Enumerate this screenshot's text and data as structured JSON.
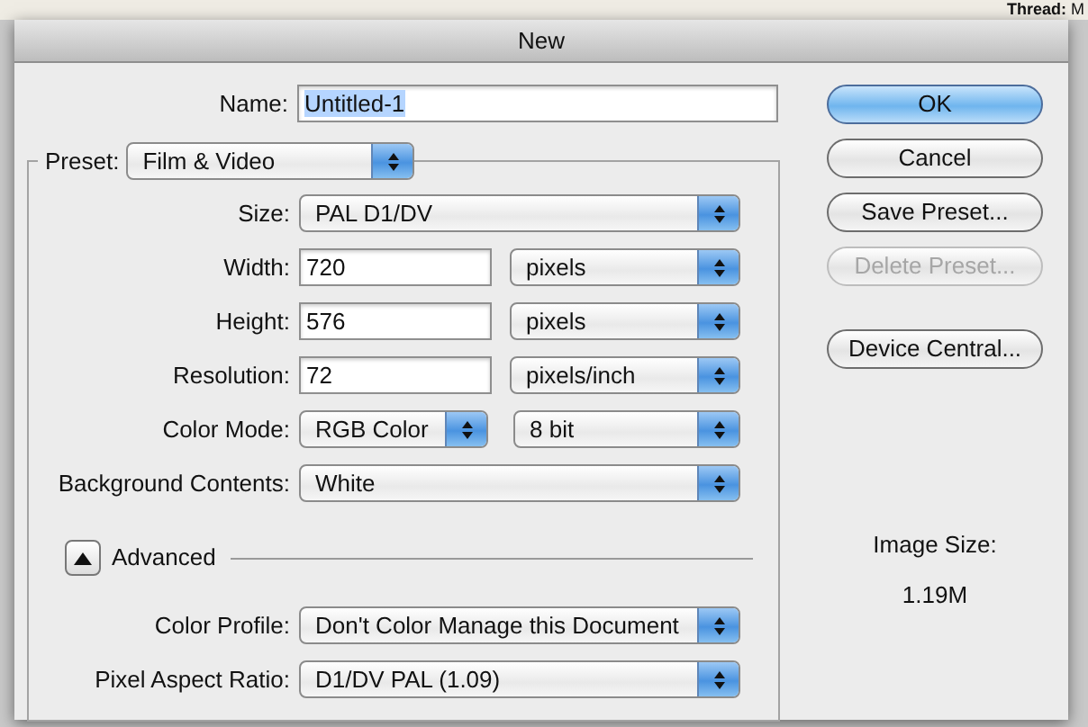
{
  "background": {
    "thread_label": "Thread:",
    "thread_value": "M"
  },
  "window": {
    "title": "New"
  },
  "name": {
    "label": "Name:",
    "value": "Untitled-1",
    "text_selected": true
  },
  "preset": {
    "label": "Preset:",
    "value": "Film & Video"
  },
  "fields": [
    {
      "kind": "popup",
      "label": "Size:",
      "value": "PAL D1/DV"
    },
    {
      "kind": "input_unit",
      "label": "Width:",
      "value": "720",
      "unit": "pixels"
    },
    {
      "kind": "input_unit",
      "label": "Height:",
      "value": "576",
      "unit": "pixels"
    },
    {
      "kind": "input_unit",
      "label": "Resolution:",
      "value": "72",
      "unit": "pixels/inch"
    },
    {
      "kind": "popup_pair",
      "label": "Color Mode:",
      "value": "RGB Color",
      "value_2": "8 bit"
    },
    {
      "kind": "popup",
      "label": "Background Contents:",
      "value": "White"
    }
  ],
  "advanced": {
    "label": "Advanced",
    "expanded": true,
    "fields": [
      {
        "kind": "popup",
        "label": "Color Profile:",
        "value": "Don't Color Manage this Document"
      },
      {
        "kind": "popup",
        "label": "Pixel Aspect Ratio:",
        "value": "D1/DV PAL (1.09)"
      }
    ]
  },
  "buttons": [
    {
      "label": "OK",
      "default": true,
      "disabled": false
    },
    {
      "label": "Cancel",
      "default": false,
      "disabled": false
    },
    {
      "label": "Save Preset...",
      "default": false,
      "disabled": false
    },
    {
      "label": "Delete Preset...",
      "default": false,
      "disabled": true
    },
    {
      "label": "Device Central...",
      "default": false,
      "disabled": false
    }
  ],
  "image_size": {
    "label": "Image Size:",
    "value": "1.19M"
  }
}
